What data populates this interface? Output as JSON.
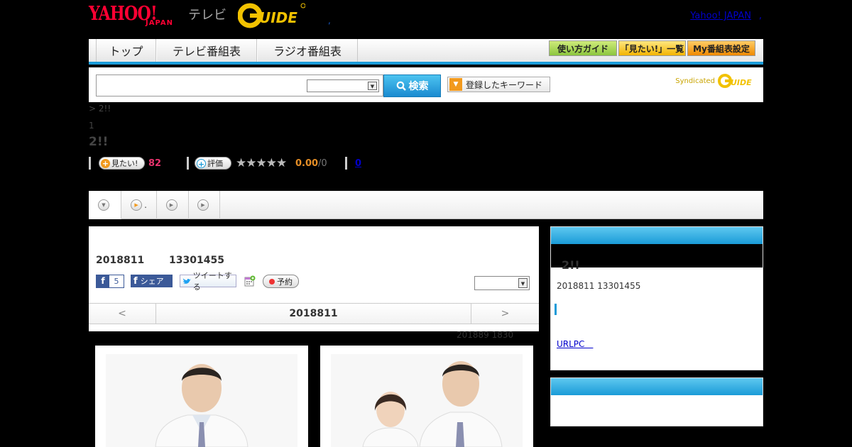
{
  "header": {
    "logo_yahoo": "YAHOO!",
    "logo_japan": "JAPAN",
    "logo_terebi": "テレビ",
    "logo_gguide": "G GUIDE",
    "dot": ",",
    "yahoo_japan_link": "Yahoo! JAPAN",
    "link_dot": ","
  },
  "nav": {
    "tabs": [
      "トップ",
      "テレビ番組表",
      "ラジオ番組表"
    ],
    "buttons": [
      "使い方ガイド",
      "「見たい!」一覧",
      "My番組表設定"
    ]
  },
  "search": {
    "input_value": "",
    "select_value": "",
    "button_label": "検索",
    "keyword_button": "登録したキーワード",
    "syndicated_label": "Syndicated",
    "syndicated_logo": "G GUIDE"
  },
  "program": {
    "breadcrumb": "> 2!!",
    "episode": "1",
    "title": "2!!",
    "want_label": "見たい!",
    "want_count": "82",
    "rate_label": "評価",
    "stars": "★★★★★",
    "score": "0.00",
    "score_of": "/0",
    "comments": "0"
  },
  "tabs": [
    {
      "label": "",
      "icon": "chevron-down-icon"
    },
    {
      "label": ".",
      "icon": "play-icon"
    },
    {
      "label": "",
      "icon": "play-icon"
    },
    {
      "label": "",
      "icon": "play-icon"
    }
  ],
  "broadcast": {
    "date": "2018811",
    "time": "13301455",
    "fb_like_count": "5",
    "fb_share": "シェア",
    "tweet": "ツイートする",
    "reserve": "予約",
    "select_value": "",
    "prev": "<",
    "current_date": "2018811",
    "next": ">",
    "updated": "201889  1830"
  },
  "sidebar": {
    "title": "2!!",
    "date_time": "2018811  13301455",
    "link": "URLPC　"
  },
  "colors": {
    "accent_blue": "#1a9bd8",
    "want_pink": "#e8336d",
    "score_orange": "#e58e26",
    "yahoo_red": "#ff0033"
  }
}
